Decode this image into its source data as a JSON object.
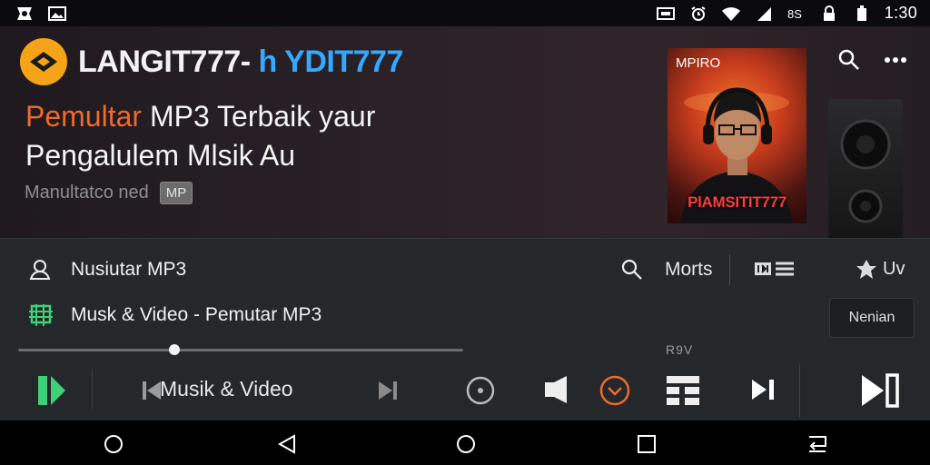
{
  "status_bar": {
    "clock": "1:30",
    "left_icons": [
      "app-icon",
      "image-icon"
    ],
    "right_icons": [
      "cast-icon",
      "alarm-icon",
      "wifi-icon",
      "signal-icon",
      "data-icon",
      "lock-icon",
      "battery-icon"
    ]
  },
  "hero": {
    "brand_prefix": "LANGIT777-",
    "brand_suffix": "h YDIT777",
    "headline_accent": "Pemultar",
    "headline_rest": " MP3 Terbaik yaur",
    "headline_line2": "Pengalulem Mlsik Au",
    "subtitle": "Manultatco ned",
    "badge": "MP",
    "cover_top_text": "MPIRO",
    "cover_bottom_text": "PlAMSITIT777"
  },
  "panel": {
    "row1_title": "Nusiutar MP3",
    "more_label": "Morts",
    "pin_label": "Uv",
    "row2_title": "Musk & Video - Pemutar MP3",
    "row2_button": "Nenian",
    "seek_progress": 0.35,
    "rev_label": "R9V",
    "now_playing_label": "Musik & Video"
  },
  "colors": {
    "accent_orange": "#ee6a2c",
    "brand_blue": "#35a8ff",
    "logo_yellow": "#f6a417",
    "green": "#3fd07a",
    "panel_bg": "#25282a"
  },
  "nav_bar": [
    "circle-icon",
    "back-icon",
    "home-icon",
    "recents-icon",
    "rotate-icon"
  ]
}
